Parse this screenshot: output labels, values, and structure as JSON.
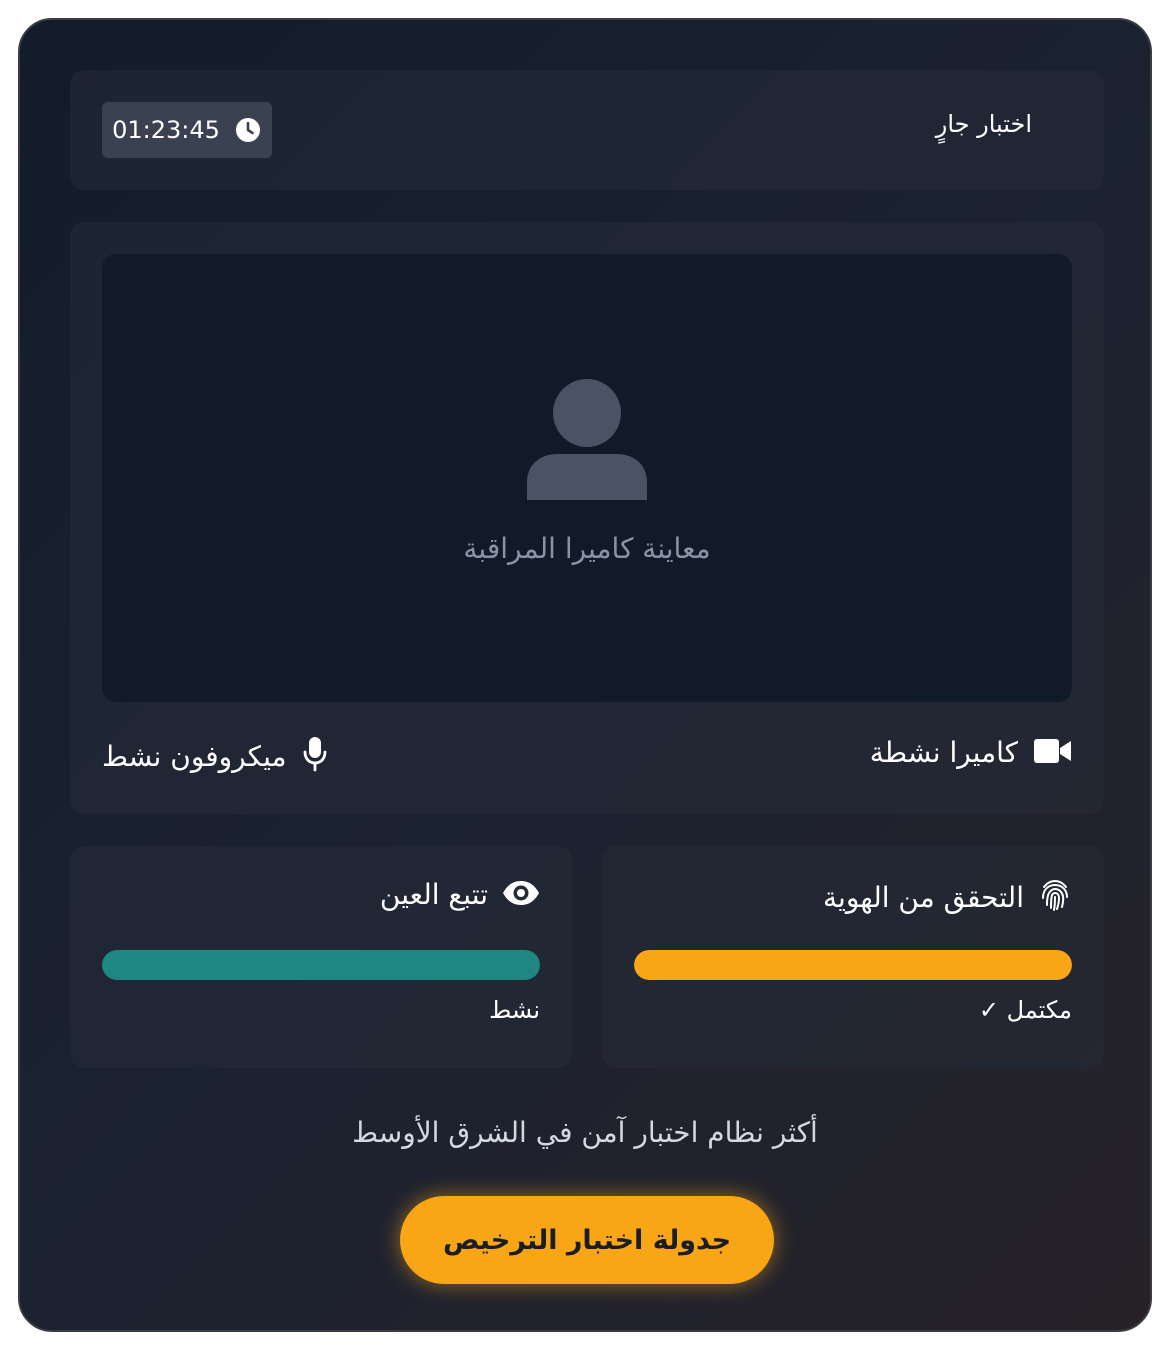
{
  "header": {
    "title": "اختبار جارٍ",
    "timer": "01:23:45",
    "timer_icon": "clock-icon"
  },
  "camera": {
    "preview_icon": "user-icon",
    "preview_label": "معاينة كاميرا المراقبة",
    "camera_status": "كاميرا نشطة",
    "camera_icon": "video-camera-icon",
    "mic_status": "ميكروفون نشط",
    "mic_icon": "microphone-icon"
  },
  "cards": {
    "identity": {
      "title": "التحقق من الهوية",
      "icon": "fingerprint-icon",
      "status": "مكتمل ✓",
      "progress": 1.0,
      "color": "#f8a516"
    },
    "eye_tracking": {
      "title": "تتبع العين",
      "icon": "eye-icon",
      "status": "نشط",
      "progress": 1.0,
      "color": "#1e8781"
    }
  },
  "footer": {
    "tagline": "أكثر نظام اختبار آمن في الشرق الأوسط",
    "cta_label": "جدولة اختبار الترخيص"
  },
  "colors": {
    "accent": "#f8a516",
    "teal": "#1e8781",
    "background": "#151d2b"
  }
}
